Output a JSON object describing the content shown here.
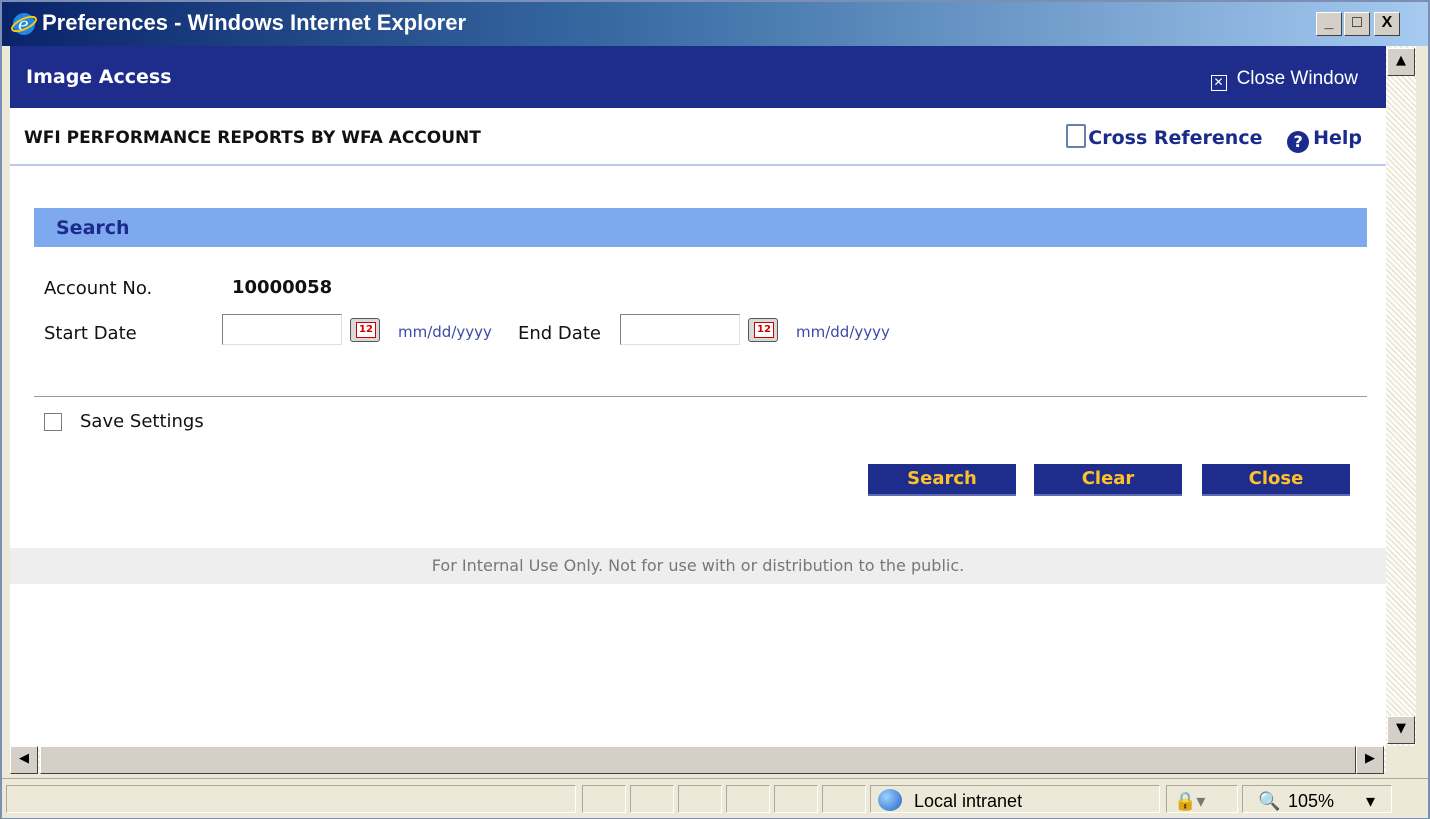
{
  "window": {
    "title": "Preferences - Windows Internet Explorer",
    "controls": {
      "minimize": "_",
      "maximize": "□",
      "close": "X"
    }
  },
  "header": {
    "app_title": "Image Access",
    "close_window_label": "Close Window"
  },
  "page": {
    "title": "WFI PERFORMANCE REPORTS BY WFA ACCOUNT",
    "cross_reference_label": "Cross Reference",
    "help_label": "Help"
  },
  "search_section": {
    "heading": "Search",
    "account_label": "Account No.",
    "account_value": "10000058",
    "start_date_label": "Start Date",
    "start_date_value": "",
    "end_date_label": "End Date",
    "end_date_value": "",
    "date_hint": "mm/dd/yyyy",
    "save_settings_label": "Save Settings",
    "save_settings_checked": false
  },
  "buttons": {
    "search": "Search",
    "clear": "Clear",
    "close": "Close"
  },
  "footer": {
    "notice": "For Internal Use Only. Not for use with or distribution to the public."
  },
  "statusbar": {
    "zone": "Local intranet",
    "zoom": "105%"
  },
  "colors": {
    "header_bg": "#1e2c8c",
    "button_text": "#ffc12b",
    "search_bar": "#7fa9ef"
  }
}
